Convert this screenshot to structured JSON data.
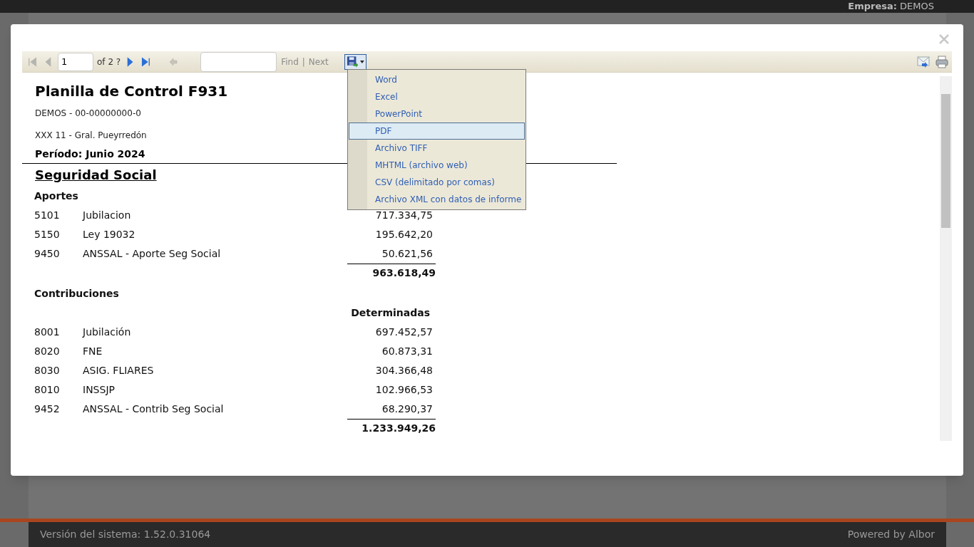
{
  "top_bar": {
    "company_label": "Empresa:",
    "company": "DEMOS"
  },
  "viewer": {
    "nav_buttons": [
      {
        "kind": "first",
        "disabled": true
      },
      {
        "kind": "prev",
        "disabled": true
      }
    ],
    "page": "1",
    "page_count": "of 2 ?",
    "nav_buttons_after": [
      {
        "kind": "next",
        "disabled": false
      },
      {
        "kind": "last",
        "disabled": false
      }
    ],
    "find_link": "Find",
    "separator": "|",
    "next_link": "Next",
    "export_menu": {
      "expanded": true,
      "items": [
        {
          "label": "Word",
          "selected": false
        },
        {
          "label": "Excel",
          "selected": false
        },
        {
          "label": "PowerPoint",
          "selected": false
        },
        {
          "label": "PDF",
          "selected": true
        },
        {
          "label": "Archivo TIFF",
          "selected": false
        },
        {
          "label": "MHTML (archivo web)",
          "selected": false
        },
        {
          "label": "CSV (delimitado por comas)",
          "selected": false
        },
        {
          "label": "Archivo XML con datos de informe",
          "selected": false
        }
      ]
    }
  },
  "report": {
    "title": "Planilla de Control F931",
    "company_line": "DEMOS - 00-00000000-0",
    "address_line": "XXX 11 - Gral. Pueyrredón",
    "period": "Período: Junio 2024",
    "section": "Seguridad Social",
    "groups": [
      {
        "title": "Aportes",
        "rows": [
          {
            "code": "5101",
            "concept": "Jubilacion",
            "amount": "717.334,75"
          },
          {
            "code": "5150",
            "concept": "Ley 19032",
            "amount": "195.642,20"
          },
          {
            "code": "9450",
            "concept": "ANSSAL - Aporte Seg Social",
            "amount": "50.621,56"
          }
        ],
        "total": "963.618,49"
      },
      {
        "title": "Contribuciones",
        "column_header": "Determinadas",
        "rows": [
          {
            "code": "8001",
            "concept": "Jubilación",
            "amount": "697.452,57"
          },
          {
            "code": "8020",
            "concept": "FNE",
            "amount": "60.873,31"
          },
          {
            "code": "8030",
            "concept": "ASIG. FLIARES",
            "amount": "304.366,48"
          },
          {
            "code": "8010",
            "concept": "INSSJP",
            "amount": "102.966,53"
          },
          {
            "code": "9452",
            "concept": "ANSSAL - Contrib Seg Social",
            "amount": "68.290,37"
          }
        ],
        "total": "1.233.949,26"
      }
    ]
  },
  "footer": {
    "version": "Versión del sistema: 1.52.0.31064",
    "powered_by": "Powered by Albor"
  }
}
